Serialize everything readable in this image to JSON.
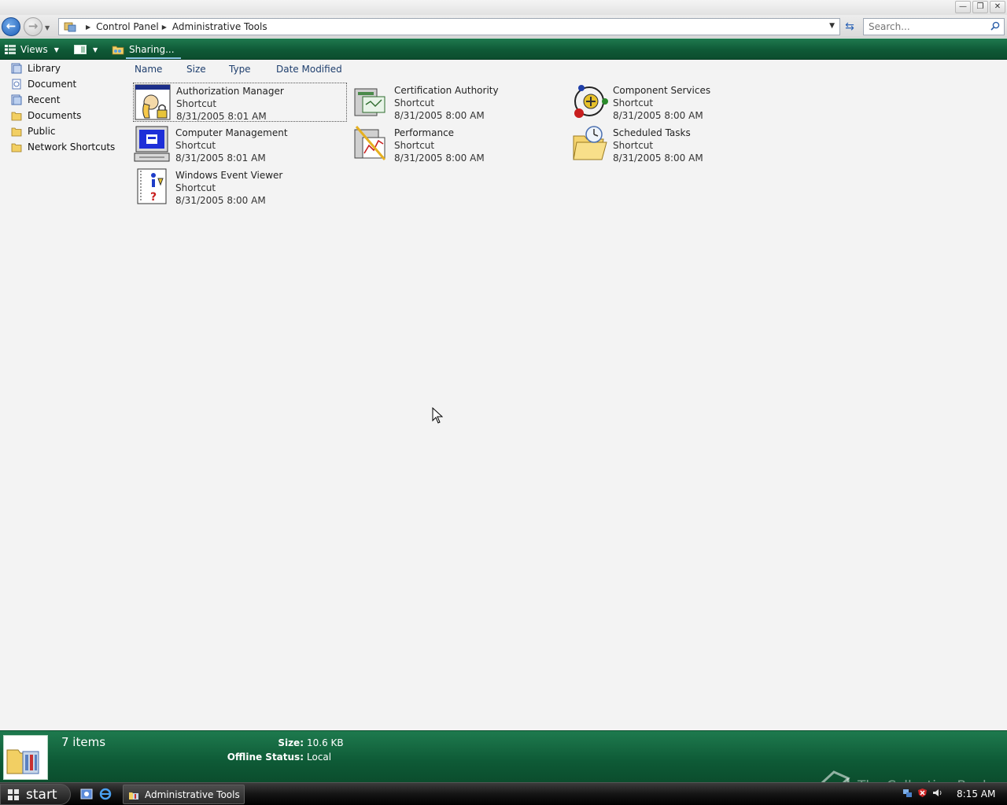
{
  "titlebar": {
    "min_glyph": "—",
    "restore_glyph": "❐",
    "close_glyph": "✕"
  },
  "nav": {
    "back_glyph": "←",
    "forward_glyph": "→",
    "history_glyph": "▼"
  },
  "address": {
    "breadcrumbs": [
      "Control Panel",
      "Administrative Tools"
    ],
    "separator_glyph": "▶",
    "dropdown_glyph": "▼",
    "refresh_glyph": "⇆"
  },
  "search": {
    "placeholder": "Search..."
  },
  "commandbar": {
    "views_label": "Views",
    "views_arrow": "▼",
    "view_toggle_arrow": "▼",
    "sharing_label": "Sharing..."
  },
  "leftnav": {
    "items": [
      {
        "label": "Library",
        "icon": "library-icon"
      },
      {
        "label": "Document",
        "icon": "document-icon"
      },
      {
        "label": "Recent",
        "icon": "recent-icon"
      },
      {
        "label": "Documents",
        "icon": "folder-icon"
      },
      {
        "label": "Public",
        "icon": "folder-icon"
      },
      {
        "label": "Network Shortcuts",
        "icon": "folder-icon"
      }
    ]
  },
  "columns": {
    "name": "Name",
    "size": "Size",
    "type": "Type",
    "date_modified": "Date Modified"
  },
  "items": [
    {
      "name": "Authorization Manager",
      "type": "Shortcut",
      "date": "8/31/2005 8:01 AM",
      "icon": "authorization-manager-icon",
      "selected": true
    },
    {
      "name": "Certification Authority",
      "type": "Shortcut",
      "date": "8/31/2005 8:00 AM",
      "icon": "certification-authority-icon",
      "selected": false
    },
    {
      "name": "Component Services",
      "type": "Shortcut",
      "date": "8/31/2005 8:00 AM",
      "icon": "component-services-icon",
      "selected": false
    },
    {
      "name": "Computer Management",
      "type": "Shortcut",
      "date": "8/31/2005 8:01 AM",
      "icon": "computer-management-icon",
      "selected": false
    },
    {
      "name": "Performance",
      "type": "Shortcut",
      "date": "8/31/2005 8:00 AM",
      "icon": "performance-icon",
      "selected": false
    },
    {
      "name": "Scheduled Tasks",
      "type": "Shortcut",
      "date": "8/31/2005 8:00 AM",
      "icon": "scheduled-tasks-icon",
      "selected": false
    },
    {
      "name": "Windows Event Viewer",
      "type": "Shortcut",
      "date": "8/31/2005 8:00 AM",
      "icon": "event-viewer-icon",
      "selected": false
    }
  ],
  "status": {
    "count": "7 items",
    "size_label": "Size:",
    "size_value": "10.6 KB",
    "offline_label": "Offline Status:",
    "offline_value": "Local",
    "watermark": "The Collection Book"
  },
  "taskbar": {
    "start_label": "start",
    "task_label": "Administrative Tools",
    "clock": "8:15 AM"
  },
  "colors": {
    "commandbar": "#0f5a37",
    "statusbar": "#0e5a36",
    "accent_blue": "#1e5fb8",
    "column_header_text": "#1f3f6e"
  }
}
